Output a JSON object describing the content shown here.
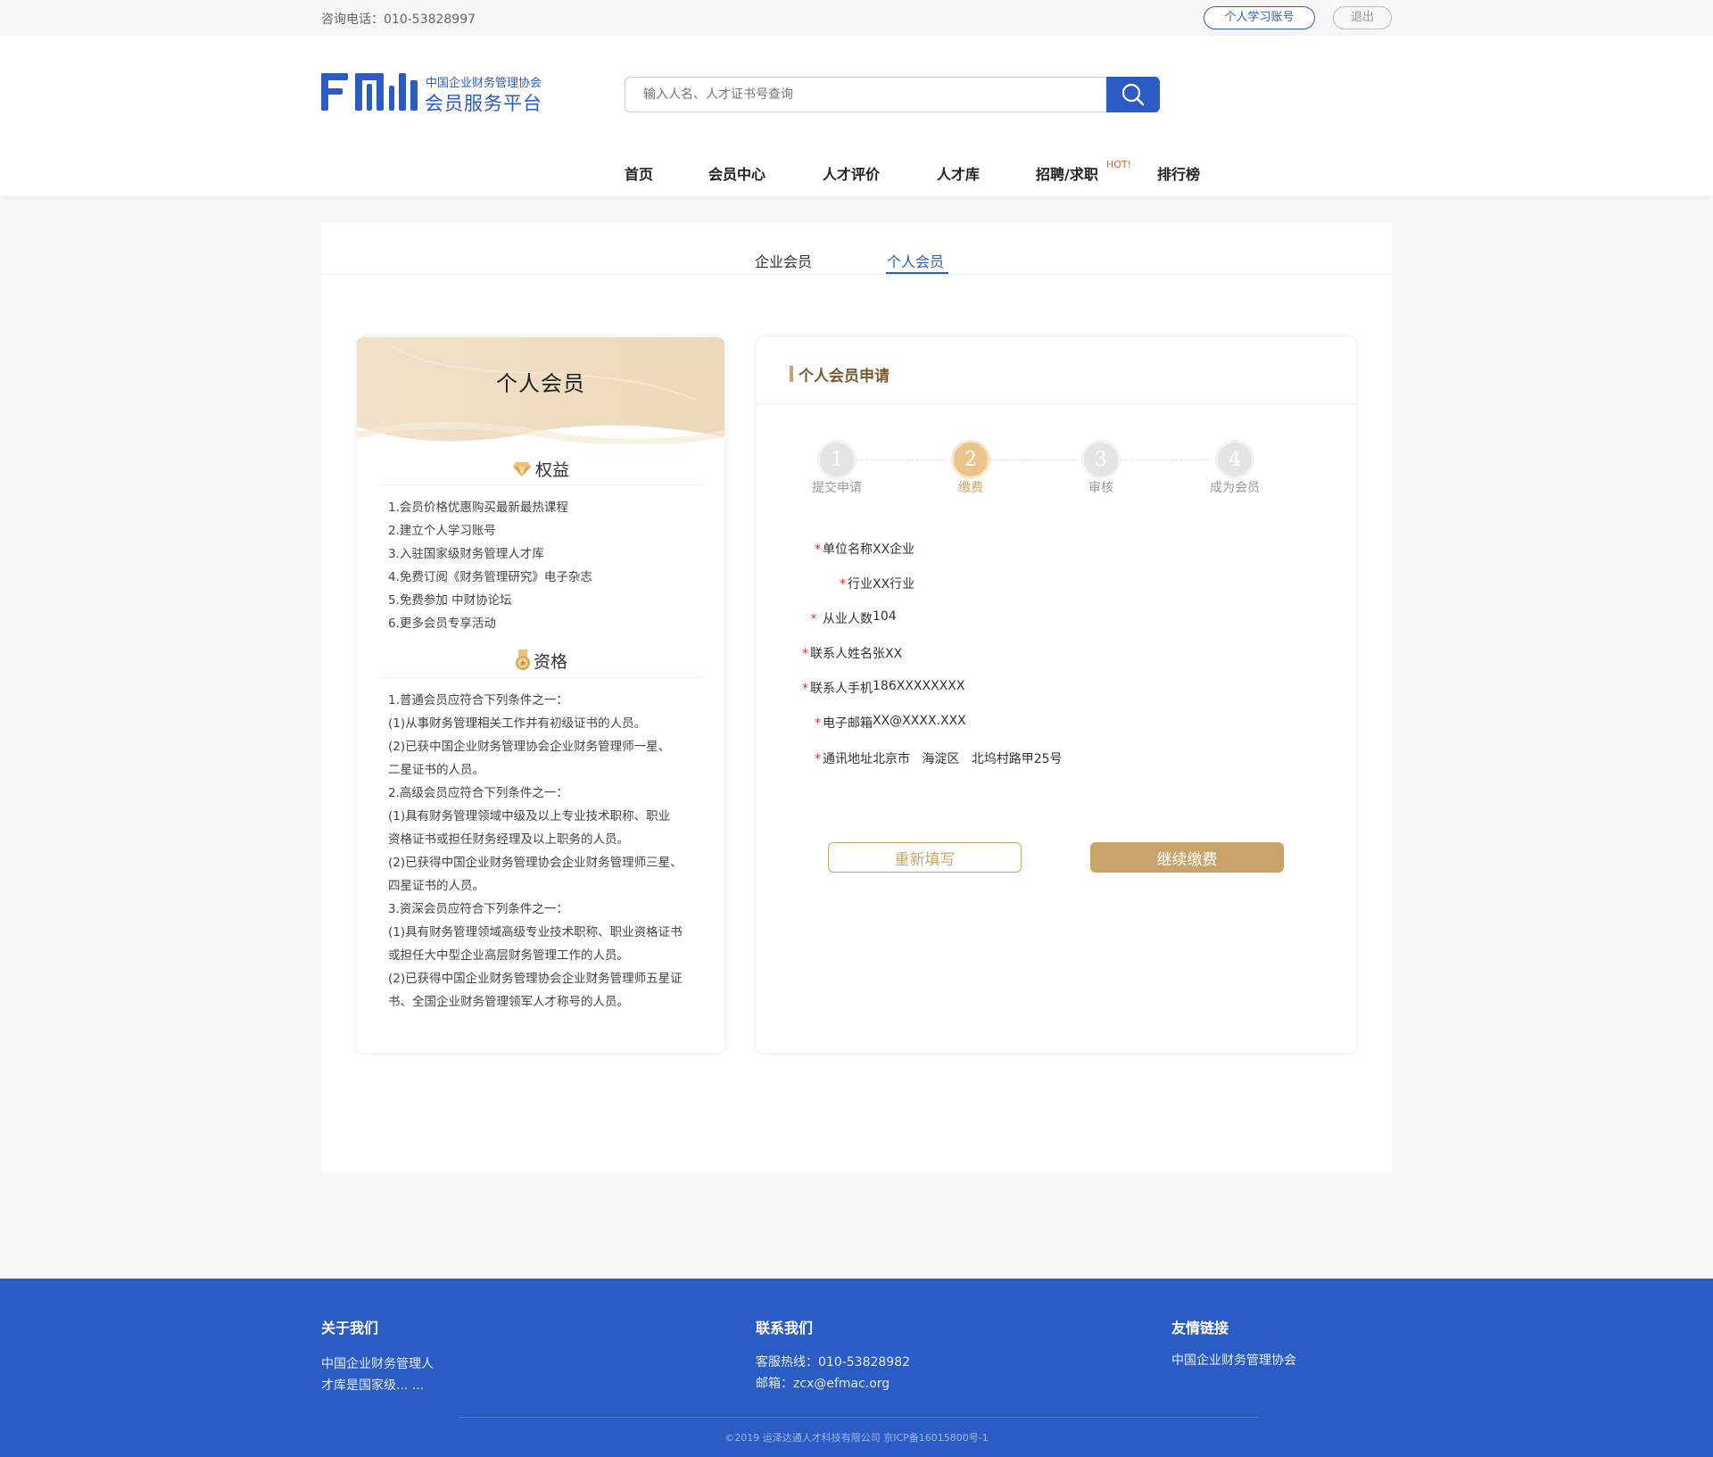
{
  "topbar": {
    "phone": "咨询电话：010-53828997",
    "study_account": "个人学习账号",
    "logout": "退出"
  },
  "header": {
    "logo_sub": "中国企业财务管理协会",
    "logo_main": "会员服务平台",
    "search_placeholder": "输入人名、人才证书号查询",
    "nav": [
      "首页",
      "会员中心",
      "人才评价",
      "人才库",
      "招聘/求职",
      "排行榜"
    ],
    "hot_badge": "HOT!"
  },
  "tabs": {
    "enterprise": "企业会员",
    "personal": "个人会员"
  },
  "left_card": {
    "title": "个人会员",
    "benefits_title": "权益",
    "benefits": [
      "1.会员价格优惠购买最新最热课程",
      "2.建立个人学习账号",
      "3.入驻国家级财务管理人才库",
      "4.免费订阅《财务管理研究》电子杂志",
      "5.免费参加 中财协论坛",
      "6.更多会员专享活动"
    ],
    "qualification_title": "资格",
    "qualifications": [
      "1.普通会员应符合下列条件之一：",
      "(1)从事财务管理相关工作并有初级证书的人员。",
      "(2)已获中国企业财务管理协会企业财务管理师一星、",
      "二星证书的人员。",
      "2.高级会员应符合下列条件之一：",
      "(1)具有财务管理领域中级及以上专业技术职称、职业",
      "资格证书或担任财务经理及以上职务的人员。",
      "(2)已获得中国企业财务管理协会企业财务管理师三星、",
      "四星证书的人员。",
      "3.资深会员应符合下列条件之一：",
      "(1)具有财务管理领域高级专业技术职称、职业资格证书",
      "或担任大中型企业高层财务管理工作的人员。",
      "(2)已获得中国企业财务管理协会企业财务管理师五星证",
      "书、全国企业财务管理领军人才称号的人员。"
    ]
  },
  "right_card": {
    "title": "个人会员申请",
    "steps": [
      {
        "num": "1",
        "label": "提交申请"
      },
      {
        "num": "2",
        "label": "缴费"
      },
      {
        "num": "3",
        "label": "审核"
      },
      {
        "num": "4",
        "label": "成为会员"
      }
    ],
    "current_step": 2,
    "required_mark": "*",
    "fields": [
      {
        "label": "单位名称",
        "value": "XX企业"
      },
      {
        "label": "行业",
        "value": "XX行业"
      },
      {
        "label": " 从业人数",
        "value": "104"
      },
      {
        "label": "联系人姓名",
        "value": "张XX"
      },
      {
        "label": "联系人手机",
        "value": "186XXXXXXXX"
      },
      {
        "label": "电子邮箱",
        "value": "XX@XXXX.XXX"
      },
      {
        "label": "通讯地址",
        "value": "北京市   海淀区   北坞村路甲25号"
      }
    ],
    "reset_label": "重新填写",
    "pay_label": "继续缴费"
  },
  "footer": {
    "about_title": "关于我们",
    "about_text_1": "中国企业财务管理人",
    "about_text_2": "才库是国家级... ...",
    "contact_title": "联系我们",
    "contact_phone": "客服热线：010-53828982",
    "contact_email": "邮箱：zcx@efmac.org",
    "links_title": "友情链接",
    "link_1": "中国企业财务管理协会",
    "copyright": "©2019 运泽达通人才科技有限公司  京ICP备16015800号-1"
  },
  "colors": {
    "brand_blue": "#2a5cc4",
    "gold": "#c8a46a",
    "required_red": "#d8332a",
    "hot_orange": "#e8612c"
  },
  "icons": {
    "search": "search-icon",
    "benefits": "diamond-icon",
    "qualification": "medal-icon"
  }
}
